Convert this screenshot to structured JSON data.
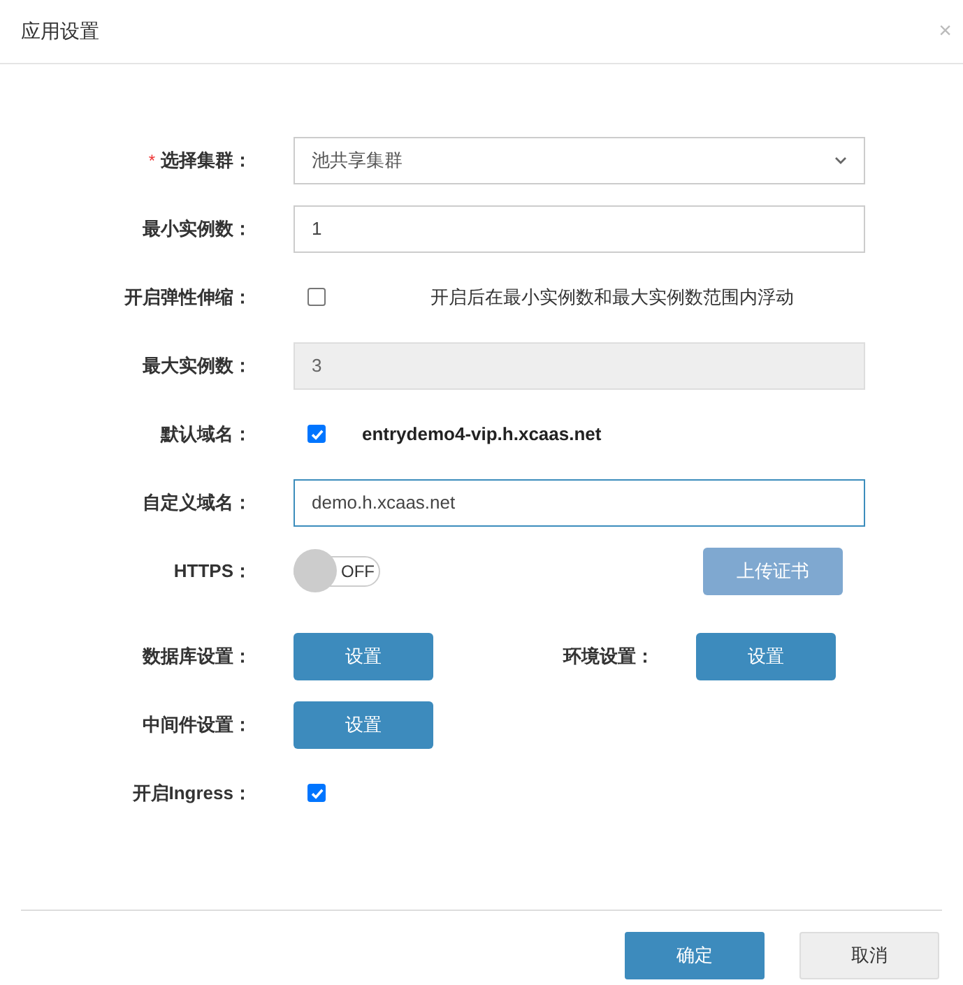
{
  "dialog": {
    "title": "应用设置",
    "close": "×"
  },
  "rows": [
    {
      "kind": "select",
      "label": "选择集群：",
      "required_mark": "*",
      "value": "池共享集群"
    },
    {
      "kind": "input",
      "label": "最小实例数：",
      "value": "1",
      "disabled": false,
      "focused": false
    },
    {
      "kind": "checkbox",
      "label": "开启弹性伸缩：",
      "checked": false,
      "note": "开启后在最小实例数和最大实例数范围内浮动",
      "note_bold": false
    },
    {
      "kind": "input",
      "label": "最大实例数：",
      "value": "3",
      "disabled": true,
      "focused": false
    },
    {
      "kind": "checkbox",
      "label": "默认域名：",
      "checked": true,
      "note": "entrydemo4-vip.h.xcaas.net",
      "note_bold": true
    },
    {
      "kind": "input",
      "label": "自定义域名：",
      "value": "demo.h.xcaas.net",
      "disabled": false,
      "focused": true
    },
    {
      "kind": "toggle",
      "label": "HTTPS：",
      "on": false,
      "state_text": "OFF",
      "side_button": {
        "label": "上传证书",
        "disabled": true
      }
    },
    {
      "kind": "buttons",
      "items": [
        {
          "label": "数据库设置：",
          "button": "设置"
        },
        {
          "label": "环境设置：",
          "button": "设置"
        }
      ]
    },
    {
      "kind": "buttons",
      "items": [
        {
          "label": "中间件设置：",
          "button": "设置"
        }
      ]
    },
    {
      "kind": "checkbox",
      "label": "开启Ingress：",
      "checked": true
    }
  ],
  "footer": {
    "buttons": [
      {
        "label": "确定",
        "primary": true
      },
      {
        "label": "取消",
        "primary": false
      }
    ]
  }
}
